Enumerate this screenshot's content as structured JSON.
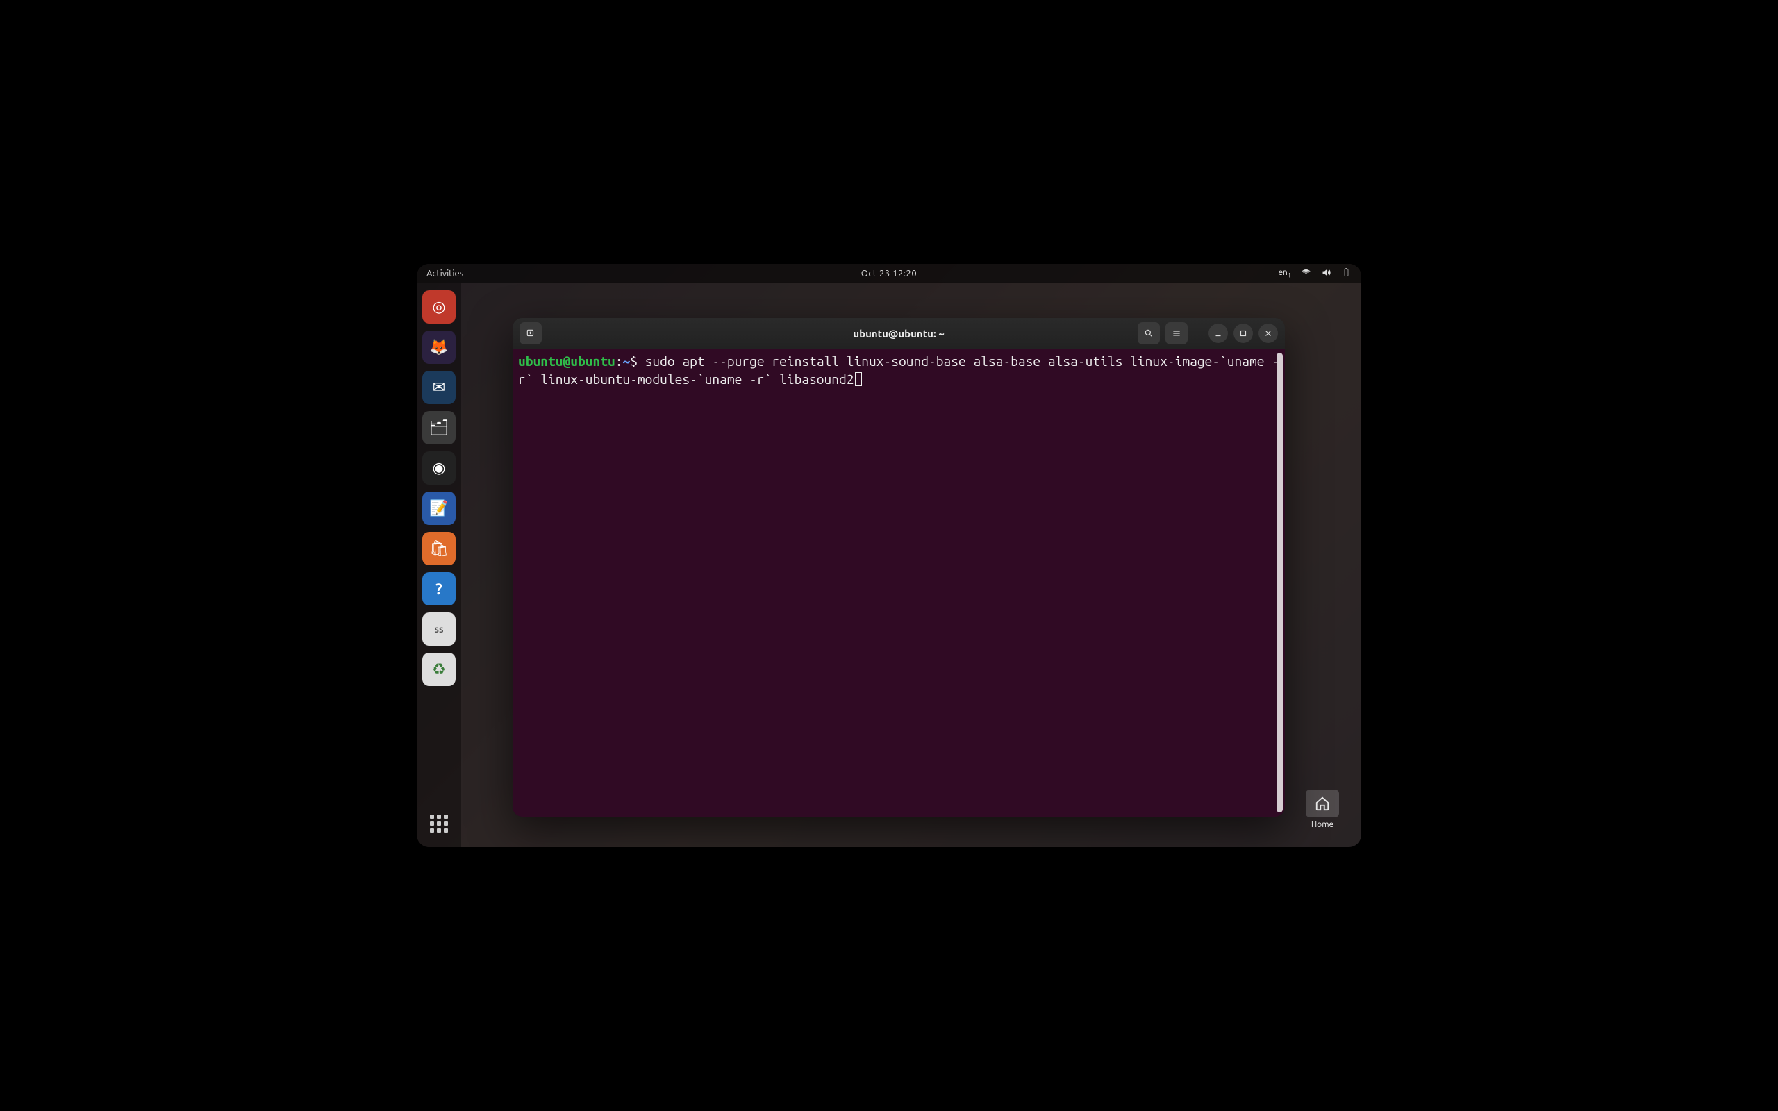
{
  "topbar": {
    "activities": "Activities",
    "clock": "Oct 23  12:20",
    "lang": "en",
    "lang_sub": "1"
  },
  "dock": {
    "items": [
      {
        "name": "installer",
        "glyph": "◎",
        "bg": "#c0392b"
      },
      {
        "name": "firefox",
        "glyph": "🦊",
        "bg": "#2b2140"
      },
      {
        "name": "thunderbird",
        "glyph": "✉",
        "bg": "#1b3a5b"
      },
      {
        "name": "files",
        "glyph": "🗂",
        "bg": "#3a3a3a"
      },
      {
        "name": "rhythmbox",
        "glyph": "◉",
        "bg": "#222"
      },
      {
        "name": "writer",
        "glyph": "📝",
        "bg": "#2a5aa8"
      },
      {
        "name": "software",
        "glyph": "🛍",
        "bg": "#e06c2b"
      },
      {
        "name": "help",
        "glyph": "?",
        "bg": "#2878c8"
      },
      {
        "name": "screenshot",
        "glyph": "ss",
        "bg": "#dedede"
      },
      {
        "name": "trash",
        "glyph": "♻",
        "bg": "#dedede"
      }
    ]
  },
  "desktop": {
    "home_label": "Home"
  },
  "terminal": {
    "title": "ubuntu@ubuntu: ~",
    "prompt": {
      "user": "ubuntu@ubuntu",
      "sep": ":",
      "path": "~",
      "sigil": "$"
    },
    "command": "sudo apt --purge reinstall linux-sound-base alsa-base alsa-utils linux-image-`uname -r` linux-ubuntu-modules-`uname -r` libasound2"
  }
}
